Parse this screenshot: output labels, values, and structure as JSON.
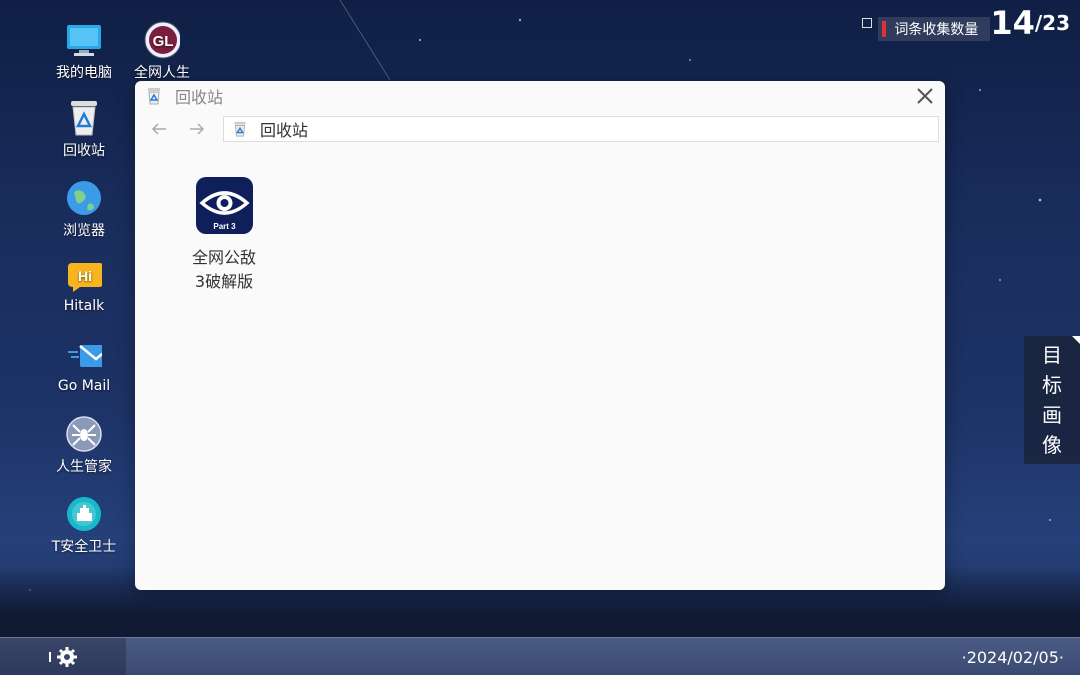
{
  "desktop": {
    "icons": [
      {
        "label": "我的电脑",
        "icon": "computer-icon"
      },
      {
        "label": "全网人生",
        "icon": "quanwang-logo-icon"
      },
      {
        "label": "回收站",
        "icon": "recycle-bin-icon"
      },
      {
        "label": "浏览器",
        "icon": "browser-globe-icon"
      },
      {
        "label": "Hitalk",
        "icon": "hitalk-icon"
      },
      {
        "label": "Go Mail",
        "icon": "mail-icon"
      },
      {
        "label": "人生管家",
        "icon": "spider-icon"
      },
      {
        "label": "T安全卫士",
        "icon": "security-guard-icon"
      }
    ]
  },
  "counter": {
    "label": "词条收集数量",
    "current": "14",
    "total": "/23",
    "accent": "#e0303a"
  },
  "window": {
    "title": "回收站",
    "address": "回收站",
    "files": [
      {
        "line1": "全网公敌",
        "line2": "3破解版",
        "icon": "eye-part3-icon",
        "badge": "Part 3"
      }
    ]
  },
  "side_tab": {
    "chars": [
      "目",
      "标",
      "画",
      "像"
    ]
  },
  "taskbar": {
    "date": "·2024/02/05·"
  }
}
